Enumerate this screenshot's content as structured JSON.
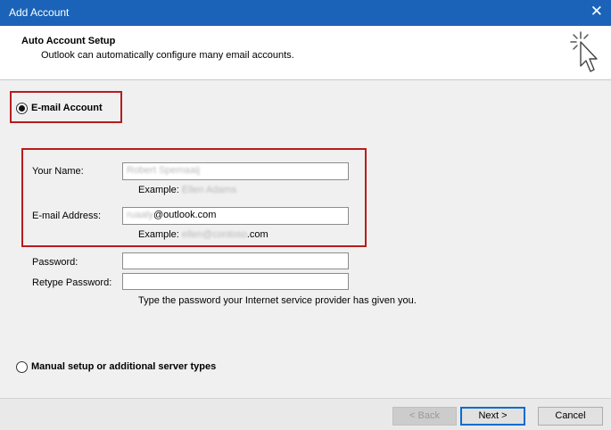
{
  "window": {
    "title": "Add Account",
    "close_glyph": "✕"
  },
  "header": {
    "title": "Auto Account Setup",
    "subtitle": "Outlook can automatically configure many email accounts.",
    "icon": "wizard-cursor-icon"
  },
  "email_account": {
    "label": "E-mail Account",
    "selected": true
  },
  "form": {
    "name_label": "Your Name:",
    "name_value": "Robert Spemaaij",
    "name_example_prefix": "Example:",
    "name_example_value": "Ellen Adams",
    "email_label": "E-mail Address:",
    "email_value_hidden": "ruaaly",
    "email_value_visible": "@outlook.com",
    "email_example_prefix": "Example:",
    "email_example_hidden": "ellen@contoso",
    "email_example_visible": ".com",
    "password_label": "Password:",
    "password_value": "",
    "retype_label": "Retype Password:",
    "retype_value": "",
    "password_hint": "Type the password your Internet service provider has given you."
  },
  "manual_setup": {
    "label": "Manual setup or additional server types",
    "selected": false
  },
  "buttons": {
    "back": "< Back",
    "next": "Next >",
    "cancel": "Cancel"
  },
  "colors": {
    "titlebar": "#1a63b8",
    "highlight_border": "#b81c1c",
    "primary_button_border": "#0b6bd0"
  }
}
